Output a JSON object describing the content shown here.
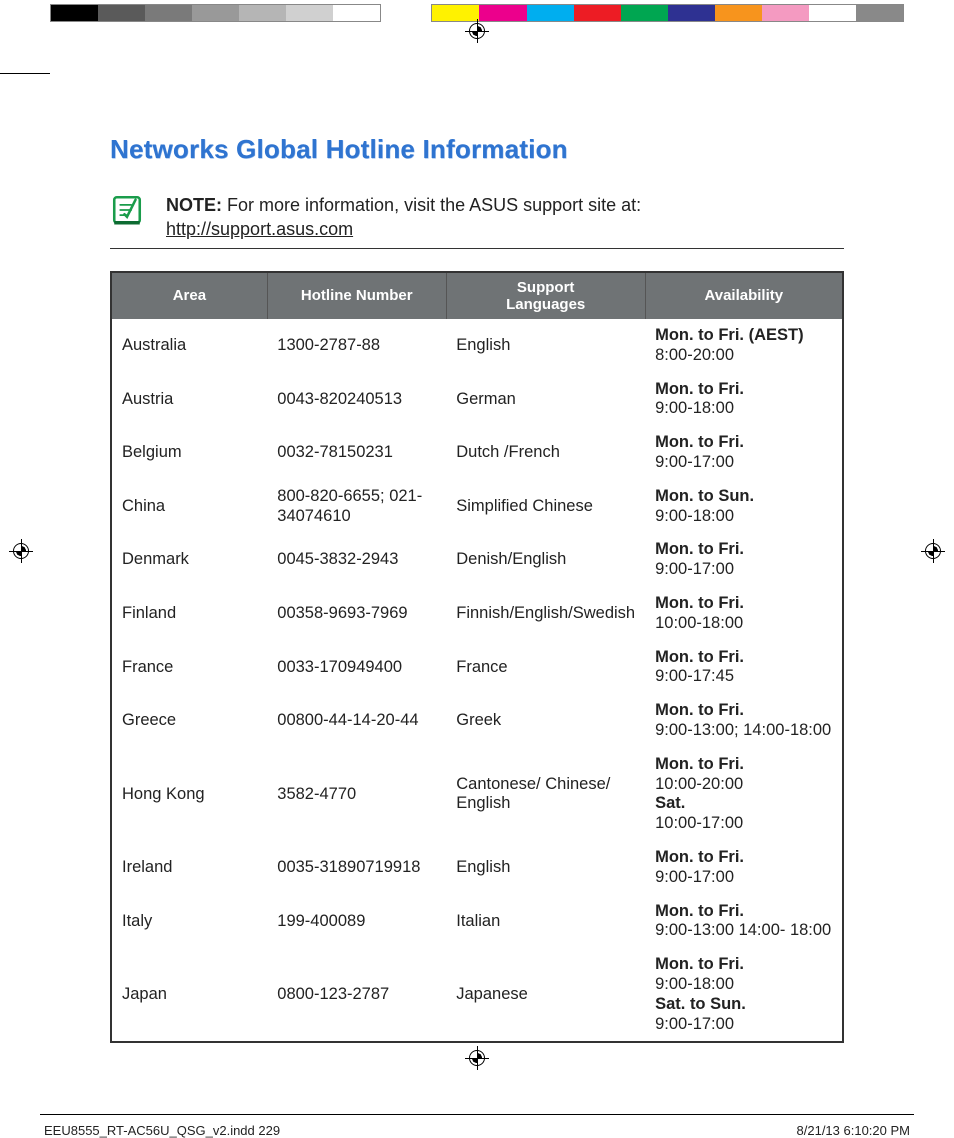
{
  "colorbar_left": [
    "#000000",
    "#5a5a5a",
    "#7a7a7a",
    "#999999",
    "#b5b5b5",
    "#d0d0d0",
    "#ffffff"
  ],
  "colorbar_right": [
    "#fff200",
    "#ec008c",
    "#00aeef",
    "#ed1c24",
    "#00a651",
    "#2e3192",
    "#f7941d",
    "#f49ac1",
    "#ffffff",
    "#898989"
  ],
  "title": "Networks Global Hotline Information",
  "note": {
    "label": "NOTE:",
    "text": "For more information, visit the ASUS support site at:",
    "link": "http://support.asus.com"
  },
  "table": {
    "headers": [
      "Area",
      "Hotline Number",
      "Support Languages",
      "Availability"
    ],
    "rows": [
      {
        "area": "Australia",
        "hotline": "1300-2787-88",
        "langs": "English",
        "avail": [
          {
            "days": "Mon. to Fri. (AEST)",
            "hours": "8:00-20:00"
          }
        ]
      },
      {
        "area": "Austria",
        "hotline": "0043-820240513",
        "langs": "German",
        "avail": [
          {
            "days": "Mon. to Fri.",
            "hours": "9:00-18:00"
          }
        ]
      },
      {
        "area": "Belgium",
        "hotline": "0032-78150231",
        "langs": "Dutch /French",
        "avail": [
          {
            "days": "Mon. to Fri.",
            "hours": "9:00-17:00"
          }
        ]
      },
      {
        "area": "China",
        "hotline": "800-820-6655; 021-34074610",
        "langs": "Simplified Chinese",
        "avail": [
          {
            "days": "Mon. to Sun.",
            "hours": "9:00-18:00"
          }
        ]
      },
      {
        "area": "Denmark",
        "hotline": "0045-3832-2943",
        "langs": "Denish/English",
        "avail": [
          {
            "days": "Mon. to Fri.",
            "hours": "9:00-17:00"
          }
        ]
      },
      {
        "area": "Finland",
        "hotline": "00358-9693-7969",
        "langs": "Finnish/English/Swedish",
        "avail": [
          {
            "days": "Mon. to Fri.",
            "hours": "10:00-18:00"
          }
        ]
      },
      {
        "area": "France",
        "hotline": "0033-170949400",
        "langs": "France",
        "avail": [
          {
            "days": "Mon. to Fri.",
            "hours": "9:00-17:45"
          }
        ]
      },
      {
        "area": "Greece",
        "hotline": "00800-44-14-20-44",
        "langs": "Greek",
        "avail": [
          {
            "days": "Mon. to Fri.",
            "hours": "9:00-13:00; 14:00-18:00"
          }
        ]
      },
      {
        "area": "Hong Kong",
        "hotline": "3582-4770",
        "langs": "Cantonese/ Chinese/ English",
        "avail": [
          {
            "days": "Mon. to Fri.",
            "hours": "10:00-20:00"
          },
          {
            "days": "Sat.",
            "hours": "10:00-17:00"
          }
        ]
      },
      {
        "area": "Ireland",
        "hotline": "0035-31890719918",
        "langs": "English",
        "avail": [
          {
            "days": "Mon. to Fri.",
            "hours": "9:00-17:00"
          }
        ]
      },
      {
        "area": "Italy",
        "hotline": "199-400089",
        "langs": "Italian",
        "avail": [
          {
            "days": "Mon. to Fri.",
            "hours": "9:00-13:00 14:00- 18:00"
          }
        ]
      },
      {
        "area": "Japan",
        "hotline": "0800-123-2787",
        "langs": "Japanese",
        "avail": [
          {
            "days": "Mon. to Fri.",
            "hours": "9:00-18:00"
          },
          {
            "days": "Sat. to Sun.",
            "hours": "9:00-17:00"
          }
        ]
      }
    ]
  },
  "footer": {
    "left": "EEU8555_RT-AC56U_QSG_v2.indd   229",
    "right": "8/21/13   6:10:20 PM"
  }
}
